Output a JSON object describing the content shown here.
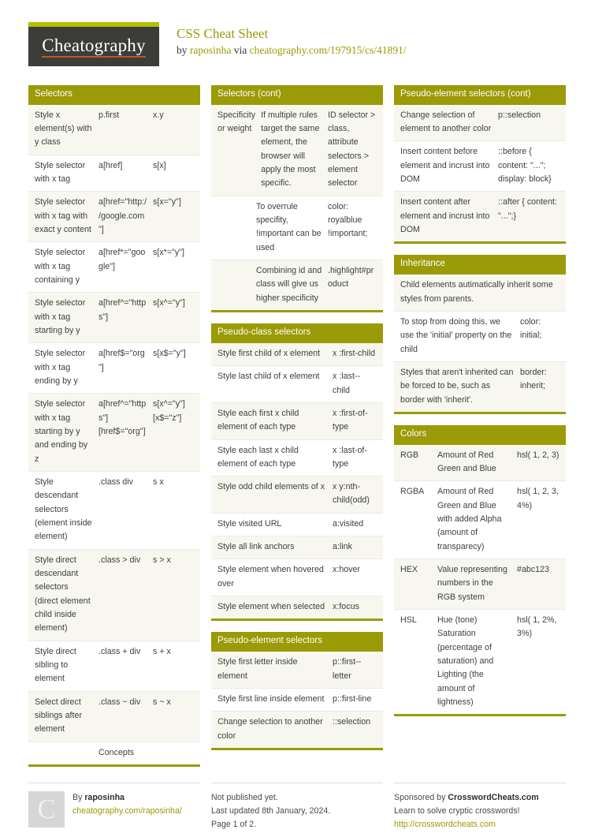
{
  "masthead": {
    "logo_text": "Cheatography",
    "title": "CSS Cheat Sheet",
    "by_prefix": "by ",
    "author": "raposinha",
    "via": " via ",
    "source_url": "cheatography.com/197915/cs/41891/"
  },
  "colors": {
    "accent_bar": "#b3c100",
    "header_olive": "#9a9b06",
    "logo_plate": "#3c3c3b",
    "logo_underline": "#c05a1f",
    "row_odd": "#f7f7ef",
    "row_even": "#ffffff",
    "row_divider": "#ebebe4"
  },
  "cards": {
    "selectors": {
      "title": "Selectors",
      "rows": [
        [
          "Style x element(s) with y class",
          "p.first",
          "x.y"
        ],
        [
          "Style selector with x tag",
          "a[href]",
          "s[x]"
        ],
        [
          "Style selector with x tag with exact y content",
          "a[href=\"http://google.com\"]",
          "s[x=\"y\"]"
        ],
        [
          "Style selector with x tag containing y",
          "a[href*=\"google\"]",
          "s[x*=\"y\"]"
        ],
        [
          "Style selector with x tag starting by y",
          "a[href^=\"https\"]",
          "s[x^=\"y\"]"
        ],
        [
          "Style selector with x tag ending by y",
          "a[href$=\"org\"]",
          "s[x$=\"y\"]"
        ],
        [
          "Style selector with x tag starting by y and ending by z",
          "a[href^=\"https\"][href$=\"org\"]",
          "s[x^=\"y\"][x$=\"z\"]"
        ],
        [
          "Style descendant selectors (element inside element)",
          ".class div",
          "s x"
        ],
        [
          "Style direct descendant selectors (direct element child inside element)",
          ".class > div",
          "s > x"
        ],
        [
          "Style direct sibling to element",
          ".class + div",
          "s + x"
        ],
        [
          "Select direct siblings after element",
          ".class ~ div",
          "s ~ x"
        ],
        [
          "",
          "Concepts",
          ""
        ]
      ]
    },
    "selectors_cont": {
      "title": "Selectors (cont)",
      "rows": [
        [
          "Specificity or weight",
          "If multiple rules target the same element, the browser will apply the most specific.",
          "ID selector > class, attribute selectors > element selector"
        ],
        [
          "",
          "To overrule specifity, !important can be used",
          "color: royalblue !important;"
        ],
        [
          "",
          "Combining id and class will give us higher specificity",
          ".highlight#product"
        ]
      ]
    },
    "pseudo_class": {
      "title": "Pseudo-class selectors",
      "rows": [
        [
          "Style first child of x element",
          "x :first-child"
        ],
        [
          "Style last child of x element",
          "x :last--child"
        ],
        [
          "Style each first x child element of each type",
          "x :first-of-type"
        ],
        [
          "Style each last x child element of each type",
          "x :last-of-type"
        ],
        [
          "Style odd child elements of x",
          "x y:nth-child(odd)"
        ],
        [
          "Style visited URL",
          "a:visited"
        ],
        [
          "Style all link anchors",
          "a:link"
        ],
        [
          "Style element when hovered over",
          "x:hover"
        ],
        [
          "Style element when selected",
          "x:focus"
        ]
      ]
    },
    "pseudo_element": {
      "title": "Pseudo-element selectors",
      "rows": [
        [
          "Style first letter inside element",
          "p::first--letter"
        ],
        [
          "Style first line inside element",
          "p::first-line"
        ],
        [
          "Change selection to another color",
          "::selection"
        ]
      ]
    },
    "pseudo_element_cont": {
      "title": "Pseudo-element selectors (cont)",
      "rows": [
        [
          "Change selection of element to another color",
          "p::selection"
        ],
        [
          "Insert content before element and incrust into DOM",
          "::before { content: \"...\"; display: block}"
        ],
        [
          "Insert content after element and incrust into DOM",
          "::after { content: \"...\";}"
        ]
      ]
    },
    "inheritance": {
      "title": "Inheritance",
      "rows": [
        [
          "Child elements autimatically inherit some styles from parents.",
          ""
        ],
        [
          "To stop from doing this, we use the 'initial' property on the child",
          "color: initial;"
        ],
        [
          "Styles that aren't inherited can be forced to be, such as border with 'inherit'.",
          "border: inherit;"
        ]
      ]
    },
    "colors_card": {
      "title": "Colors",
      "rows": [
        [
          "RGB",
          "Amount of Red Green and Blue",
          "hsl( 1, 2, 3)"
        ],
        [
          "RGBA",
          "Amount of Red Green and Blue with added Alpha (amount of transparecy)",
          "hsl( 1, 2, 3, 4%)"
        ],
        [
          "HEX",
          "Value representing numbers in the RGB system",
          "#abc123"
        ],
        [
          "HSL",
          "Hue (tone) Saturation (percentage of saturation) and Lighting (the amount of lightness)",
          "hsl( 1, 2%, 3%)"
        ]
      ]
    }
  },
  "footer": {
    "author": {
      "avatar_letter": "C",
      "by_prefix": "By ",
      "name": "raposinha",
      "url": "cheatography.com/raposinha/"
    },
    "publish": {
      "line1": "Not published yet.",
      "line2": "Last updated 8th January, 2024.",
      "line3": "Page 1 of 2."
    },
    "sponsor": {
      "prefix": "Sponsored by ",
      "name": "CrosswordCheats.com",
      "tagline": "Learn to solve cryptic crosswords!",
      "url": "http://crosswordcheats.com"
    }
  }
}
